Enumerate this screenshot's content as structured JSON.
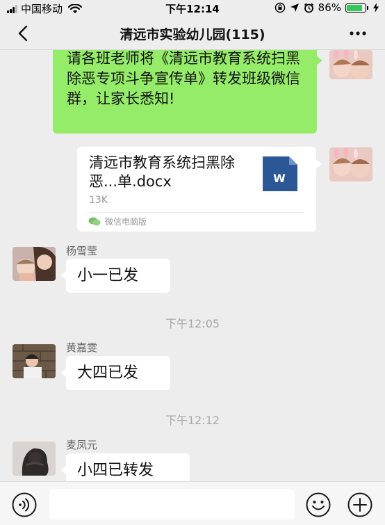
{
  "status_bar": {
    "carrier": "中国移动",
    "time": "下午12:14",
    "battery_percent": "86%",
    "battery_level": 0.86
  },
  "header": {
    "title": "清远市实验幼儿园(115)"
  },
  "messages": [
    {
      "type": "text",
      "direction": "sent",
      "text": "请各班老师将《清远市教育系统扫黑除恶专项斗争宣传单》转发班级微信群，让家长悉知!"
    },
    {
      "type": "file",
      "direction": "sent",
      "file_name": "清远市教育系统扫黑除恶...单.docx",
      "file_size": "13K",
      "file_type_letter": "W",
      "source": "微信电脑版"
    },
    {
      "type": "text",
      "direction": "received",
      "sender": "杨雪莹",
      "text": "小一已发"
    },
    {
      "type": "time",
      "text": "下午12:05"
    },
    {
      "type": "text",
      "direction": "received",
      "sender": "黄嘉雯",
      "text": "大四已发"
    },
    {
      "type": "time",
      "text": "下午12:12"
    },
    {
      "type": "text",
      "direction": "received",
      "sender": "麦凤元",
      "text": "小四已转发"
    }
  ],
  "colors": {
    "background": "#ededed",
    "sent_bubble": "#95ec69",
    "received_bubble": "#ffffff",
    "word_icon": "#2b5797",
    "battery": "#34c759"
  },
  "icons": {
    "back": "chevron-left-icon",
    "more": "more-dots-icon",
    "voice": "voice-icon",
    "emoji": "emoji-icon",
    "plus": "plus-icon",
    "wifi": "wifi-icon",
    "file": "word-document-icon"
  },
  "input_bar": {
    "placeholder": ""
  }
}
